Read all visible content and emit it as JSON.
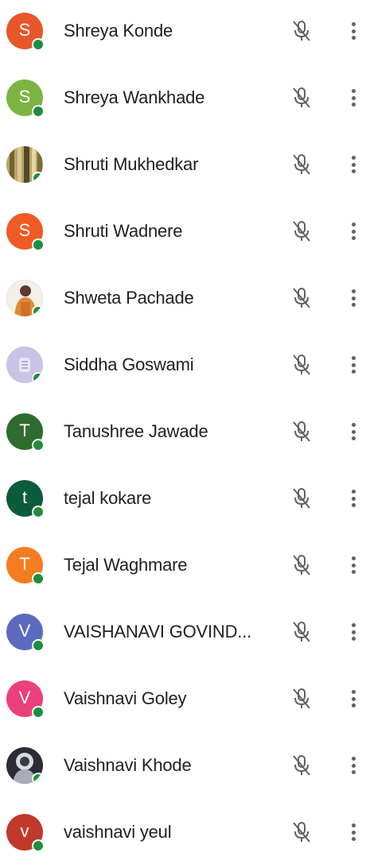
{
  "participants": [
    {
      "name": "Shreya Konde",
      "initial": "S",
      "color": "#e8562b",
      "avatar_type": "letter"
    },
    {
      "name": "Shreya Wankhade",
      "initial": "S",
      "color": "#7cb342",
      "avatar_type": "letter"
    },
    {
      "name": "Shruti Mukhedkar",
      "initial": "",
      "color": "#8d7d48",
      "avatar_type": "photo"
    },
    {
      "name": "Shruti Wadnere",
      "initial": "S",
      "color": "#f05a24",
      "avatar_type": "letter"
    },
    {
      "name": "Shweta Pachade",
      "initial": "",
      "color": "#c97b3b",
      "avatar_type": "photo"
    },
    {
      "name": "Siddha Goswami",
      "initial": "",
      "color": "#c9c3e6",
      "avatar_type": "photo"
    },
    {
      "name": "Tanushree Jawade",
      "initial": "T",
      "color": "#2e6b2f",
      "avatar_type": "letter"
    },
    {
      "name": "tejal kokare",
      "initial": "t",
      "color": "#0b5c3b",
      "avatar_type": "letter"
    },
    {
      "name": "Tejal Waghmare",
      "initial": "T",
      "color": "#f57c1f",
      "avatar_type": "letter"
    },
    {
      "name": "VAISHANAVI GOVIND...",
      "initial": "V",
      "color": "#5c6bc0",
      "avatar_type": "letter"
    },
    {
      "name": "Vaishnavi Goley",
      "initial": "V",
      "color": "#ec407a",
      "avatar_type": "letter"
    },
    {
      "name": "Vaishnavi Khode",
      "initial": "",
      "color": "#6f6f75",
      "avatar_type": "photo"
    },
    {
      "name": "vaishnavi yeul",
      "initial": "v",
      "color": "#c0392b",
      "avatar_type": "letter"
    }
  ],
  "icons": {
    "mic": "mic-off-icon",
    "more": "more-vert-icon",
    "status": "online-status-dot"
  },
  "colors": {
    "status_online": "#1e8e3e",
    "icon_gray": "#5f6368",
    "text": "#202124"
  }
}
